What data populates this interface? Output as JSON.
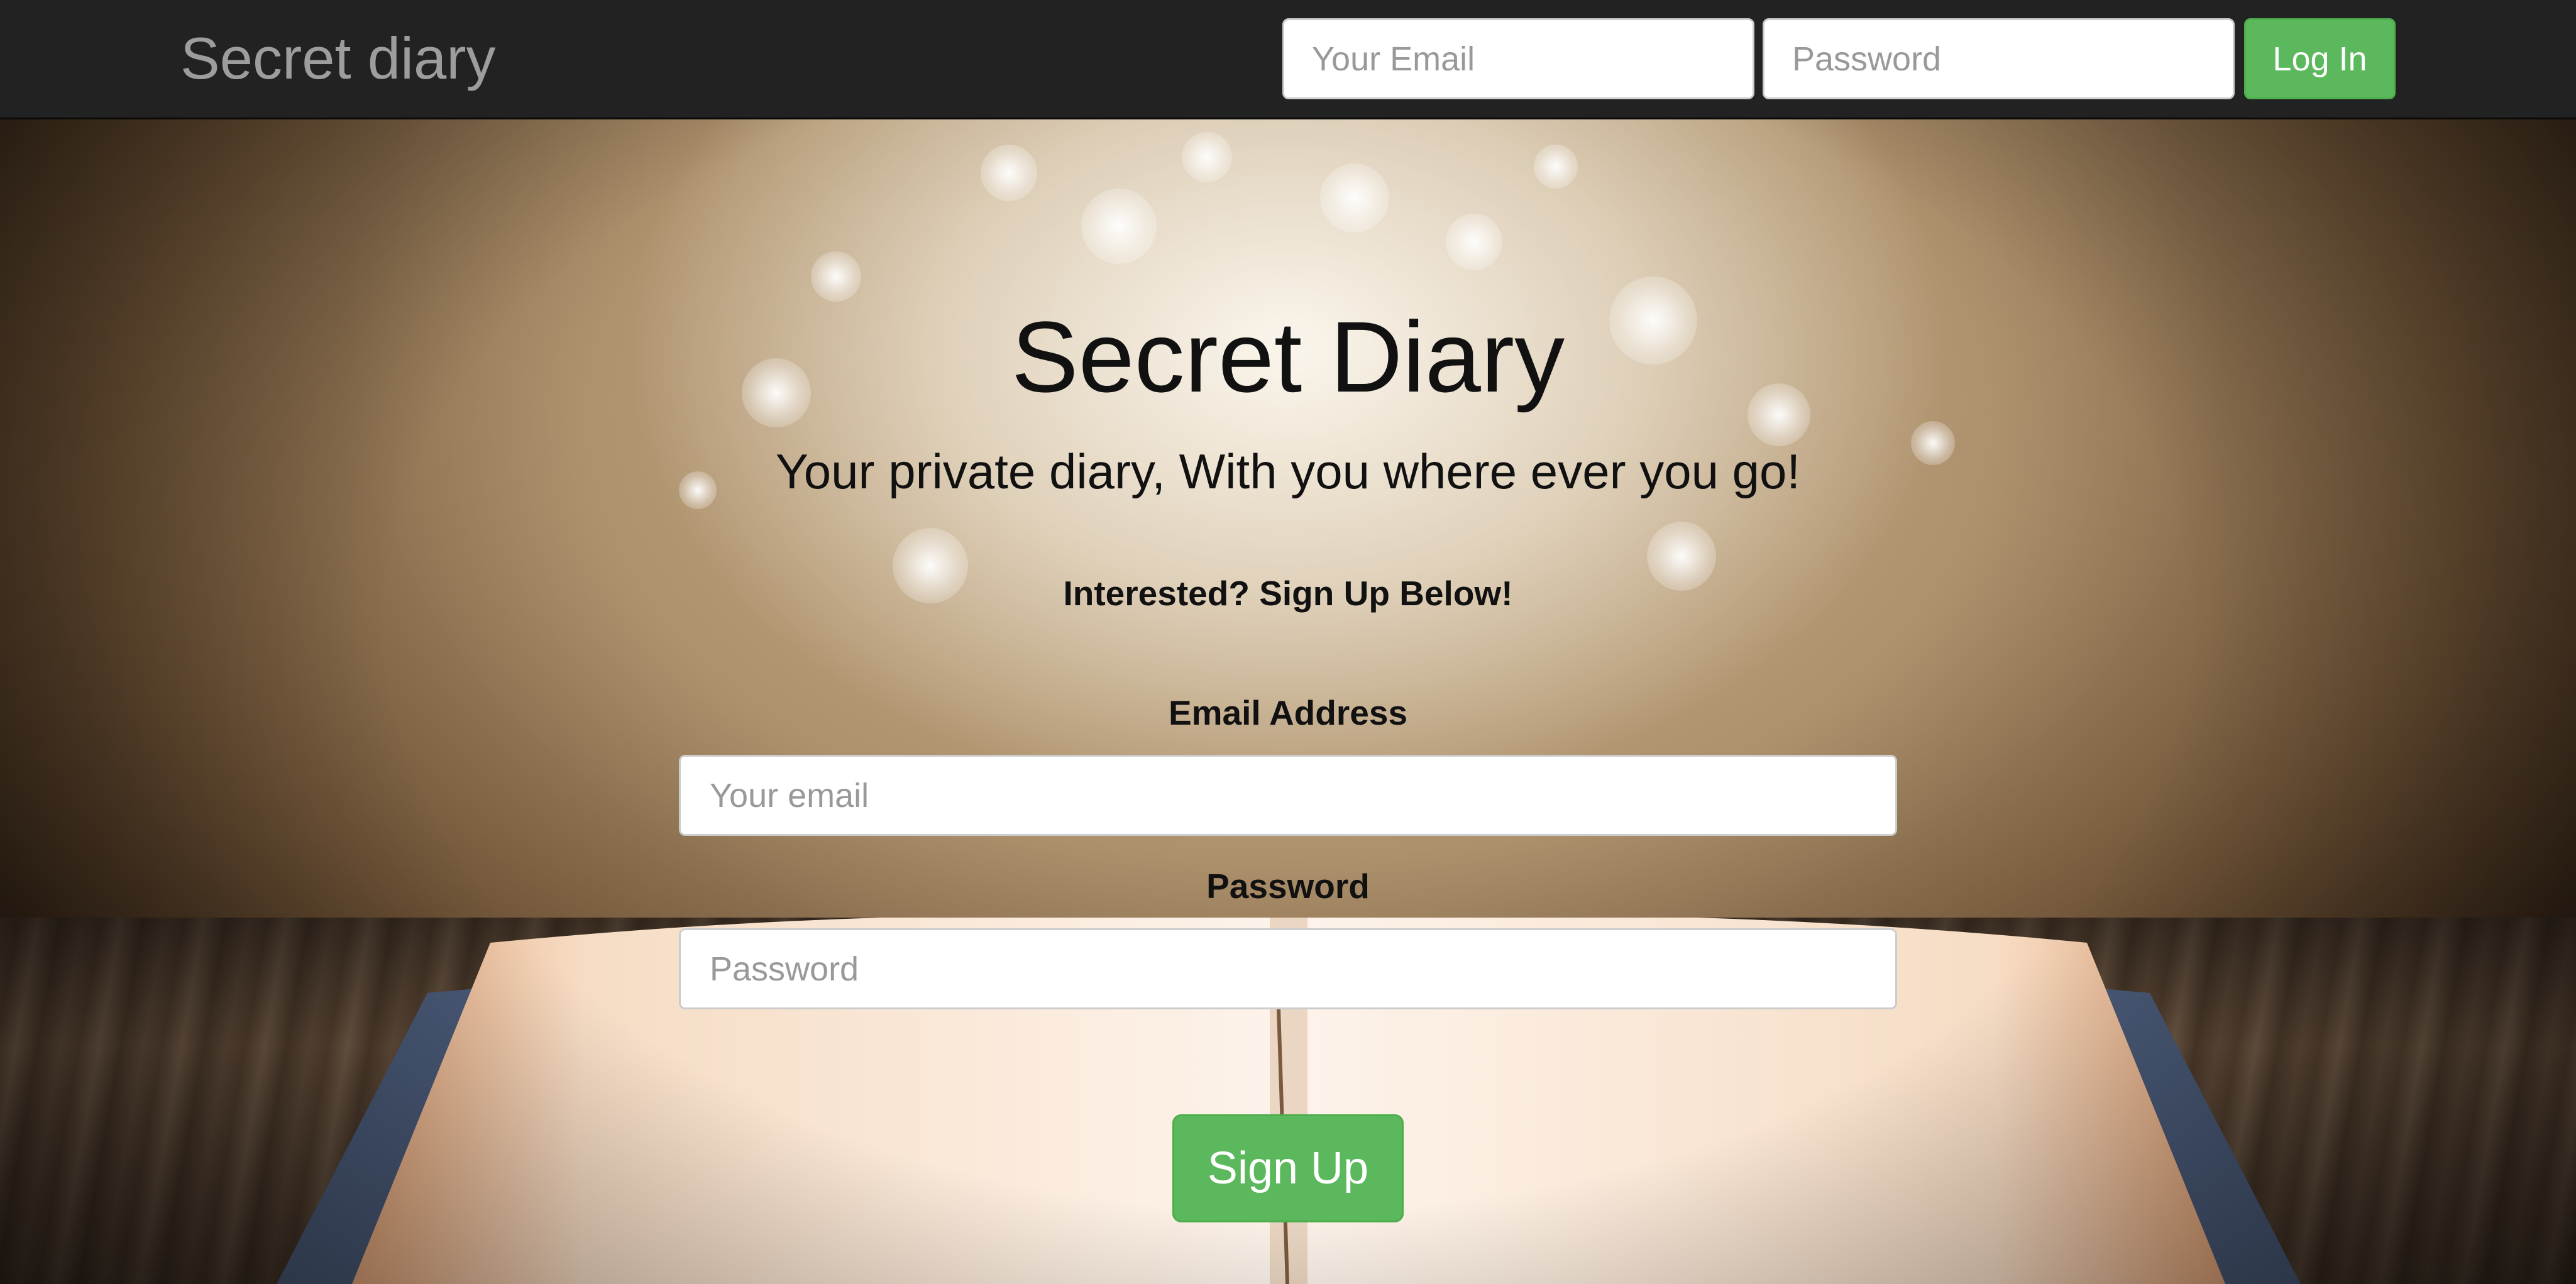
{
  "navbar": {
    "brand": "Secret diary",
    "email_placeholder": "Your Email",
    "password_placeholder": "Password",
    "login_label": "Log In"
  },
  "hero": {
    "title": "Secret Diary",
    "subtitle": "Your private diary, With you where ever you go!"
  },
  "signup": {
    "heading": "Interested? Sign Up Below!",
    "email_label": "Email Address",
    "email_placeholder": "Your email",
    "password_label": "Password",
    "password_placeholder": "Password",
    "button_label": "Sign Up"
  },
  "colors": {
    "navbar_bg": "#222222",
    "brand_text": "#9d9d9d",
    "success_green": "#5cb85c",
    "input_border": "#cccccc"
  },
  "background": {
    "description_icon": "open-book-background-image"
  }
}
